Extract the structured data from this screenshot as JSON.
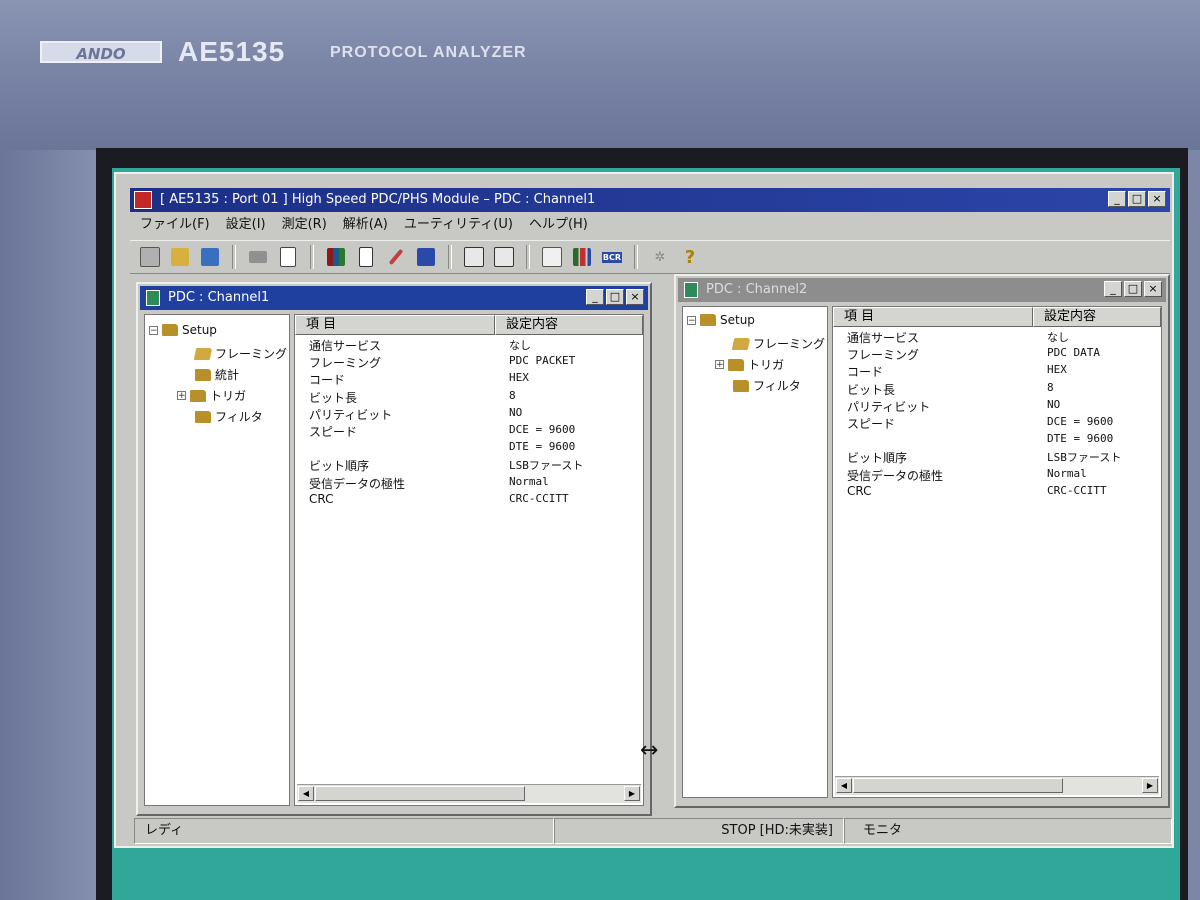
{
  "device": {
    "brand": "ANDO",
    "model": "AE5135",
    "product": "PROTOCOL ANALYZER"
  },
  "app": {
    "title": "[ AE5135 : Port 01 ] High Speed PDC/PHS Module  – PDC : Channel1",
    "window_buttons": [
      "_",
      "□",
      "×"
    ]
  },
  "menu": [
    "ファイル(F)",
    "設定(I)",
    "測定(R)",
    "解析(A)",
    "ユーティリティ(U)",
    "ヘルプ(H)"
  ],
  "toolbar": {
    "icons": [
      "copy-icon",
      "upload-icon",
      "download-icon",
      "print-icon",
      "document-icon",
      "books-icon",
      "edit-icon",
      "pencil-icon",
      "terminal-icon",
      "report-icon",
      "frame-icon",
      "list-icon",
      "bar-chart-icon",
      "bcr-icon",
      "settings-icon",
      "help-icon"
    ],
    "bcr_label": "BCR",
    "help_label": "?"
  },
  "columns": {
    "item": "項  目",
    "setting": "設定内容"
  },
  "channel1": {
    "title": "PDC : Channel1",
    "tree": {
      "root": "Setup",
      "children": [
        "フレーミング",
        "統計",
        "トリガ",
        "フィルタ"
      ]
    },
    "rows": [
      {
        "item": "通信サービス",
        "value": "なし"
      },
      {
        "item": "フレーミング",
        "value": "PDC PACKET"
      },
      {
        "item": "コード",
        "value": "HEX"
      },
      {
        "item": "ビット長",
        "value": "8"
      },
      {
        "item": "パリティビット",
        "value": "NO"
      },
      {
        "item": "スピード",
        "value": "DCE = 9600"
      },
      {
        "item": "",
        "value": "DTE = 9600"
      },
      {
        "item": "ビット順序",
        "value": "LSBファースト"
      },
      {
        "item": "受信データの極性",
        "value": "Normal"
      },
      {
        "item": "CRC",
        "value": "CRC-CCITT"
      }
    ]
  },
  "channel2": {
    "title": "PDC : Channel2",
    "tree": {
      "root": "Setup",
      "children": [
        "フレーミング",
        "トリガ",
        "フィルタ"
      ]
    },
    "rows": [
      {
        "item": "通信サービス",
        "value": "なし"
      },
      {
        "item": "フレーミング",
        "value": "PDC DATA"
      },
      {
        "item": "コード",
        "value": "HEX"
      },
      {
        "item": "ビット長",
        "value": "8"
      },
      {
        "item": "パリティビット",
        "value": "NO"
      },
      {
        "item": "スピード",
        "value": "DCE = 9600"
      },
      {
        "item": "",
        "value": "DTE = 9600"
      },
      {
        "item": "ビット順序",
        "value": "LSBファースト"
      },
      {
        "item": "受信データの極性",
        "value": "Normal"
      },
      {
        "item": "CRC",
        "value": "CRC-CCITT"
      }
    ]
  },
  "statusbar": {
    "left": "レディ",
    "center": "STOP [HD:未実装]",
    "right": "モニタ"
  },
  "colors": {
    "active_title": "#2040a0",
    "inactive_title": "#8d8d8d",
    "desktop": "#2fa89a"
  }
}
